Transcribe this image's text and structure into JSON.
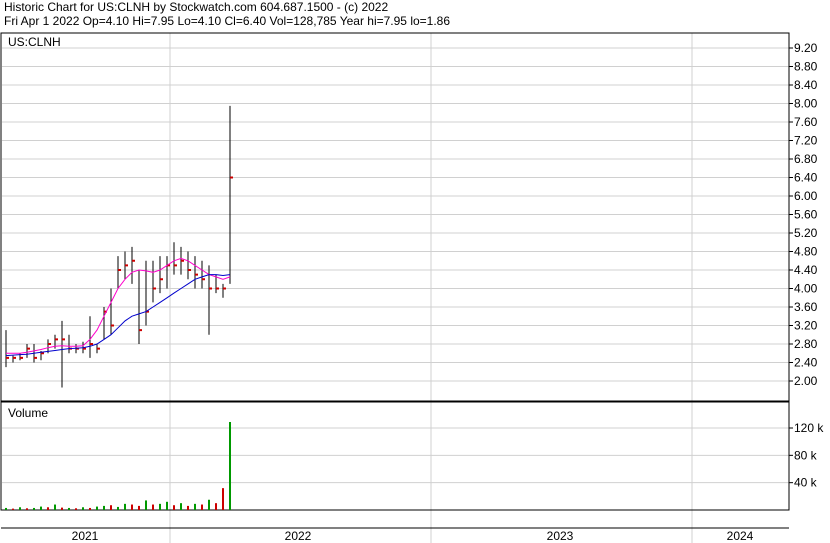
{
  "header": {
    "line1": "Historic Chart for US:CLNH by Stockwatch.com 604.687.1500 - (c) 2022",
    "line2": "Fri Apr  1 2022   Op=4.10   Hi=7.95   Lo=4.10   Cl=6.40   Vol=128,785   Year hi=7.95   lo=1.86"
  },
  "chart_data": {
    "type": "ohlc",
    "symbol_label": "US:CLNH",
    "volume_label": "Volume",
    "price_axis": {
      "min": 1.6,
      "max": 9.4,
      "ticks": [
        "9.20",
        "8.80",
        "8.40",
        "8.00",
        "7.60",
        "7.20",
        "6.80",
        "6.40",
        "6.00",
        "5.60",
        "5.20",
        "4.80",
        "4.40",
        "4.00",
        "3.60",
        "3.20",
        "2.80",
        "2.40",
        "2.00"
      ]
    },
    "volume_axis": {
      "min": 0,
      "max": 140000,
      "ticks": [
        "120 k",
        "80 k",
        "40 k"
      ]
    },
    "year_labels": [
      "2021",
      "2022",
      "2023",
      "2024"
    ],
    "colors": {
      "up": "#009900",
      "down": "#cc0000",
      "ma_short": "#ff00cc",
      "ma_long": "#0000cc",
      "grid": "#d0d0d0"
    },
    "last_bar": {
      "open": 4.1,
      "high": 7.95,
      "low": 4.1,
      "close": 6.4,
      "volume": 128785
    },
    "series": [
      {
        "t": 0,
        "h": 3.1,
        "l": 2.3,
        "c": 2.5
      },
      {
        "t": 1,
        "h": 2.55,
        "l": 2.4,
        "c": 2.5
      },
      {
        "t": 2,
        "h": 2.6,
        "l": 2.45,
        "c": 2.5
      },
      {
        "t": 3,
        "h": 2.8,
        "l": 2.5,
        "c": 2.7
      },
      {
        "t": 4,
        "h": 2.8,
        "l": 2.4,
        "c": 2.5
      },
      {
        "t": 5,
        "h": 2.65,
        "l": 2.45,
        "c": 2.6
      },
      {
        "t": 6,
        "h": 2.9,
        "l": 2.6,
        "c": 2.8
      },
      {
        "t": 7,
        "h": 3.0,
        "l": 2.7,
        "c": 2.9
      },
      {
        "t": 8,
        "h": 3.3,
        "l": 1.86,
        "c": 2.9
      },
      {
        "t": 9,
        "h": 3.0,
        "l": 2.6,
        "c": 2.7
      },
      {
        "t": 10,
        "h": 2.8,
        "l": 2.6,
        "c": 2.7
      },
      {
        "t": 11,
        "h": 2.85,
        "l": 2.6,
        "c": 2.7
      },
      {
        "t": 12,
        "h": 3.4,
        "l": 2.5,
        "c": 2.8
      },
      {
        "t": 13,
        "h": 2.8,
        "l": 2.6,
        "c": 2.7
      },
      {
        "t": 14,
        "h": 3.6,
        "l": 2.9,
        "c": 3.5
      },
      {
        "t": 15,
        "h": 4.0,
        "l": 3.0,
        "c": 3.2
      },
      {
        "t": 16,
        "h": 4.7,
        "l": 4.0,
        "c": 4.4
      },
      {
        "t": 17,
        "h": 4.8,
        "l": 4.2,
        "c": 4.5
      },
      {
        "t": 18,
        "h": 4.9,
        "l": 4.1,
        "c": 4.6
      },
      {
        "t": 19,
        "h": 4.4,
        "l": 2.8,
        "c": 3.1
      },
      {
        "t": 20,
        "h": 4.6,
        "l": 3.2,
        "c": 3.5
      },
      {
        "t": 21,
        "h": 4.6,
        "l": 3.7,
        "c": 4.0
      },
      {
        "t": 22,
        "h": 4.7,
        "l": 3.9,
        "c": 4.2
      },
      {
        "t": 23,
        "h": 4.7,
        "l": 4.0,
        "c": 4.5
      },
      {
        "t": 24,
        "h": 5.0,
        "l": 4.3,
        "c": 4.5
      },
      {
        "t": 25,
        "h": 4.9,
        "l": 4.3,
        "c": 4.6
      },
      {
        "t": 26,
        "h": 4.8,
        "l": 4.2,
        "c": 4.4
      },
      {
        "t": 27,
        "h": 4.7,
        "l": 4.0,
        "c": 4.3
      },
      {
        "t": 28,
        "h": 4.6,
        "l": 4.0,
        "c": 4.2
      },
      {
        "t": 29,
        "h": 4.5,
        "l": 3.0,
        "c": 4.0
      },
      {
        "t": 30,
        "h": 4.3,
        "l": 3.9,
        "c": 4.0
      },
      {
        "t": 31,
        "h": 4.1,
        "l": 3.8,
        "c": 4.0
      },
      {
        "t": 32,
        "h": 7.95,
        "l": 4.1,
        "c": 6.4
      }
    ],
    "ma_short": [
      2.6,
      2.6,
      2.6,
      2.62,
      2.65,
      2.68,
      2.72,
      2.75,
      2.76,
      2.75,
      2.75,
      2.76,
      2.9,
      3.1,
      3.4,
      3.7,
      4.0,
      4.2,
      4.35,
      4.4,
      4.38,
      4.35,
      4.4,
      4.5,
      4.6,
      4.65,
      4.6,
      4.5,
      4.4,
      4.3,
      4.25,
      4.2,
      4.25
    ],
    "ma_long": [
      2.55,
      2.56,
      2.57,
      2.58,
      2.6,
      2.62,
      2.64,
      2.66,
      2.68,
      2.7,
      2.71,
      2.72,
      2.75,
      2.8,
      2.9,
      3.0,
      3.15,
      3.3,
      3.4,
      3.45,
      3.5,
      3.6,
      3.7,
      3.8,
      3.9,
      4.0,
      4.1,
      4.2,
      4.25,
      4.3,
      4.3,
      4.28,
      4.3
    ],
    "volumes": [
      3000,
      2000,
      4000,
      2500,
      3000,
      5000,
      4000,
      8000,
      3500,
      3000,
      2500,
      4000,
      3000,
      5000,
      6000,
      7000,
      4500,
      9000,
      8000,
      6000,
      14000,
      8000,
      9000,
      12000,
      7000,
      10000,
      6000,
      9000,
      8000,
      15000,
      10000,
      32000,
      128785
    ],
    "volume_up": [
      true,
      false,
      true,
      false,
      true,
      true,
      false,
      true,
      false,
      true,
      false,
      true,
      false,
      true,
      true,
      false,
      true,
      true,
      false,
      false,
      true,
      false,
      true,
      true,
      false,
      true,
      false,
      true,
      false,
      true,
      false,
      false,
      true
    ]
  }
}
